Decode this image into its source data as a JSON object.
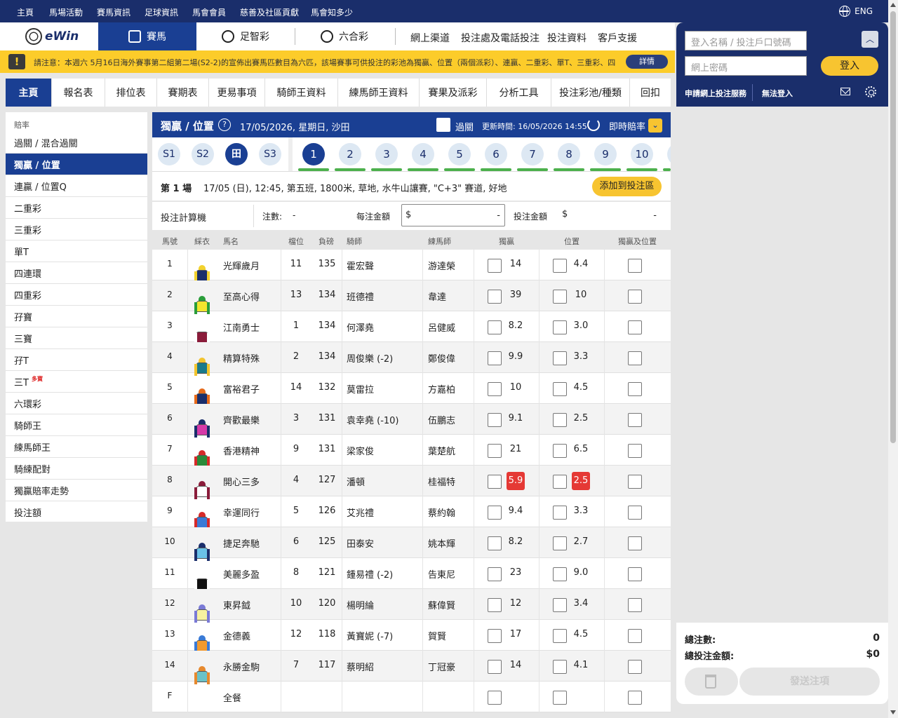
{
  "topbar": {
    "items": [
      "主頁",
      "馬場活動",
      "賽馬資訊",
      "足球資訊",
      "馬會會員",
      "慈善及社區貢獻",
      "馬會知多少"
    ],
    "lang": "ENG"
  },
  "nav": {
    "logo": "eWin",
    "tabs": [
      "賽馬",
      "足智彩",
      "六合彩"
    ],
    "links": [
      "網上渠道",
      "投注處及電話投注",
      "投注資料",
      "客戶支援"
    ]
  },
  "notice": {
    "text": "請注意：本週六 5月16日海外賽事第二組第二場(S2-2)的宣佈出賽馬匹數目為六匹，該場賽事可供投注的彩池為獨贏、位置（兩個派彩）、連贏、二重彩、單T、三重彩、四",
    "button": "詳情"
  },
  "subnav": [
    "主頁",
    "報名表",
    "排位表",
    "賽期表",
    "更易事項",
    "騎師王資料",
    "練馬師王資料",
    "賽果及派彩",
    "分析工具",
    "投注彩池/種類",
    "回扣"
  ],
  "sidebar": {
    "heading": "賠率",
    "items": [
      "過關 / 混合過關",
      "獨贏 / 位置",
      "連贏 / 位置Q",
      "二重彩",
      "三重彩",
      "單T",
      "四連環",
      "四重彩",
      "孖寶",
      "三寶",
      "孖T",
      "三T",
      "六環彩",
      "騎師王",
      "練馬師王",
      "騎練配對",
      "獨贏賠率走勢",
      "投注額"
    ],
    "tag": "多寶"
  },
  "header": {
    "title": "獨贏 / 位置",
    "help": "?",
    "date": "17/05/2026, 星期日, 沙田",
    "guoguan": "過關",
    "updated": "更新時間: 16/05/2026 14:55",
    "live_odds": "即時賠率"
  },
  "venues": [
    "S1",
    "S2",
    "田",
    "S3"
  ],
  "races": [
    "1",
    "2",
    "3",
    "4",
    "5",
    "6",
    "7",
    "8",
    "9",
    "10"
  ],
  "raceinfo": {
    "race": "第 1 場",
    "detail": "17/05 (日), 12:45, 第五班, 1800米, 草地, 水牛山讓賽, \"C+3\" 賽道, 好地",
    "add_button": "添加到投注區"
  },
  "calc": {
    "label": "投注計算機",
    "count_label": "注數:",
    "count_value": "-",
    "unit_label": "每注金額",
    "dollar": "$",
    "unit_minus": "-",
    "total_label": "投注金額",
    "total_dollar": "$",
    "total_value": "-"
  },
  "columns": [
    "馬號",
    "綵衣",
    "馬名",
    "檔位",
    "負磅",
    "騎師",
    "練馬師",
    "獨贏",
    "位置",
    "獨贏及位置"
  ],
  "horses": [
    {
      "no": "1",
      "name": "光輝歲月",
      "draw": "11",
      "wt": "135",
      "jockey": "霍宏聲",
      "trainer": "游達榮",
      "win": "14",
      "pla": "4.4",
      "colors": [
        "#1a2e6b",
        "#f2d22e"
      ]
    },
    {
      "no": "2",
      "name": "至高心得",
      "draw": "13",
      "wt": "134",
      "jockey": "班德禮",
      "trainer": "韋達",
      "win": "39",
      "pla": "10",
      "colors": [
        "#f2e52e",
        "#2a9d3a"
      ]
    },
    {
      "no": "3",
      "name": "江南勇士",
      "draw": "1",
      "wt": "134",
      "jockey": "何澤堯",
      "trainer": "呂健威",
      "win": "8.2",
      "pla": "3.0",
      "colors": [
        "#8a1c3a",
        "#ffffff"
      ]
    },
    {
      "no": "4",
      "name": "精算特殊",
      "draw": "2",
      "wt": "134",
      "jockey": "周俊樂 (-2)",
      "trainer": "鄭俊偉",
      "win": "9.9",
      "pla": "3.3",
      "colors": [
        "#1a7a8a",
        "#f2c42e"
      ]
    },
    {
      "no": "5",
      "name": "富裕君子",
      "draw": "14",
      "wt": "132",
      "jockey": "莫雷拉",
      "trainer": "方嘉柏",
      "win": "10",
      "pla": "4.5",
      "colors": [
        "#1a2e6b",
        "#e66a1a"
      ]
    },
    {
      "no": "6",
      "name": "齊歡最樂",
      "draw": "3",
      "wt": "131",
      "jockey": "袁幸堯 (-10)",
      "trainer": "伍鵬志",
      "win": "9.1",
      "pla": "2.5",
      "colors": [
        "#d63aa8",
        "#1a2e6b"
      ]
    },
    {
      "no": "7",
      "name": "香港精神",
      "draw": "9",
      "wt": "131",
      "jockey": "梁家俊",
      "trainer": "葉楚航",
      "win": "21",
      "pla": "6.5",
      "colors": [
        "#2a8a3a",
        "#d62a2a"
      ]
    },
    {
      "no": "8",
      "name": "開心三多",
      "draw": "4",
      "wt": "127",
      "jockey": "潘頓",
      "trainer": "桂福特",
      "win": "5.9",
      "pla": "2.5",
      "colors": [
        "#ffffff",
        "#8a1c3a"
      ],
      "hot": true
    },
    {
      "no": "9",
      "name": "幸運同行",
      "draw": "5",
      "wt": "126",
      "jockey": "艾兆禮",
      "trainer": "蔡約翰",
      "win": "9.4",
      "pla": "3.3",
      "colors": [
        "#3a7ad6",
        "#d62a2a"
      ]
    },
    {
      "no": "10",
      "name": "捷足奔馳",
      "draw": "6",
      "wt": "125",
      "jockey": "田泰安",
      "trainer": "姚本輝",
      "win": "8.2",
      "pla": "2.7",
      "colors": [
        "#6ac2e8",
        "#1a2e6b"
      ]
    },
    {
      "no": "11",
      "name": "美麗多盈",
      "draw": "8",
      "wt": "121",
      "jockey": "鍾易禮 (-2)",
      "trainer": "告東尼",
      "win": "23",
      "pla": "9.0",
      "colors": [
        "#111111",
        "#ffffff"
      ]
    },
    {
      "no": "12",
      "name": "東昇鉞",
      "draw": "10",
      "wt": "120",
      "jockey": "楊明綸",
      "trainer": "蘇偉賢",
      "win": "12",
      "pla": "3.4",
      "colors": [
        "#f7f2a0",
        "#7a7ad6"
      ]
    },
    {
      "no": "13",
      "name": "金德義",
      "draw": "12",
      "wt": "118",
      "jockey": "黃寶妮 (-7)",
      "trainer": "賀賢",
      "win": "17",
      "pla": "4.5",
      "colors": [
        "#f29a2e",
        "#3a7ad6"
      ]
    },
    {
      "no": "14",
      "name": "永勝金駒",
      "draw": "7",
      "wt": "117",
      "jockey": "蔡明紹",
      "trainer": "丁冠豪",
      "win": "14",
      "pla": "4.1",
      "colors": [
        "#6ac2c8",
        "#e6892e"
      ]
    },
    {
      "no": "F",
      "name": "全餐",
      "draw": "",
      "wt": "",
      "jockey": "",
      "trainer": "",
      "win": "",
      "pla": "",
      "colors": null
    }
  ],
  "login": {
    "user_placeholder": "登入名稱 / 投注戶口號碼",
    "pass_placeholder": "網上密碼",
    "login_button": "登入",
    "apply": "申請網上投注服務",
    "cannot_login": "無法登入"
  },
  "slip": {
    "total_bets_label": "總注數:",
    "total_bets": "0",
    "total_amount_label": "總投注金額:",
    "total_amount": "$0",
    "send": "發送注項"
  },
  "theme": {
    "brand": "#1a3f93",
    "accent": "#f7c430",
    "hot": "#e53935",
    "green": "#4cb04c"
  }
}
